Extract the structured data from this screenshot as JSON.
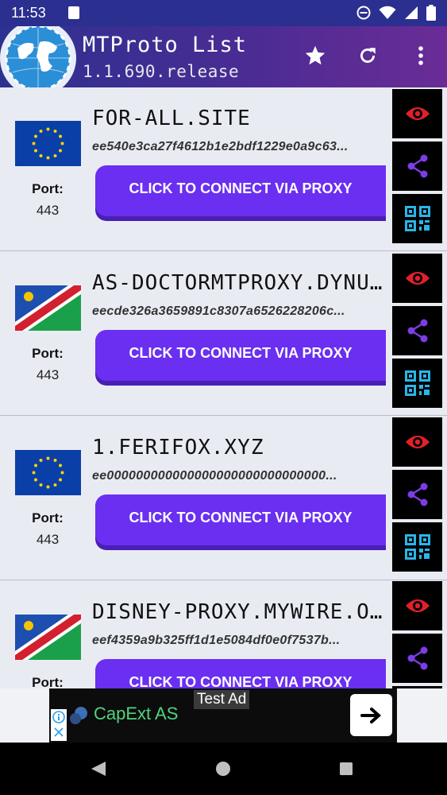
{
  "status": {
    "time": "11:53"
  },
  "app": {
    "title": "MTProto List",
    "version": "1.1.690.release"
  },
  "colors": {
    "appbar_start": "#2c3190",
    "appbar_end": "#6a2c96",
    "button": "#6a2ff0",
    "eye": "#e0202a",
    "share": "#7b3de6",
    "qr": "#29b6e8"
  },
  "proxies": [
    {
      "host": "FOR-ALL.SITE",
      "secret": "ee540e3ca27f4612b1e2bdf1229e0a9c63...",
      "port_label": "Port:",
      "port": "443",
      "flag": "eu-flag-icon",
      "button": "CLICK TO CONNECT VIA PROXY"
    },
    {
      "host": "AS-DOCTORMTPROXY.DYNU...",
      "secret": "eecde326a3659891c8307a6526228206c...",
      "port_label": "Port:",
      "port": "443",
      "flag": "namibia-flag-icon",
      "button": "CLICK TO CONNECT VIA PROXY"
    },
    {
      "host": "1.FERIFOX.XYZ",
      "secret": "ee000000000000000000000000000000...",
      "port_label": "Port:",
      "port": "443",
      "flag": "eu-flag-icon",
      "button": "CLICK TO CONNECT VIA PROXY"
    },
    {
      "host": "DISNEY-PROXY.MYWIRE.O...",
      "secret": "eef4359a9b325ff1d1e5084df0e0f7537b...",
      "port_label": "Port:",
      "port": "",
      "flag": "namibia-flag-icon",
      "button": "CLICK TO CONNECT VIA PROXY"
    }
  ],
  "ad": {
    "label": "Test Ad",
    "text": "CapExt AS"
  }
}
